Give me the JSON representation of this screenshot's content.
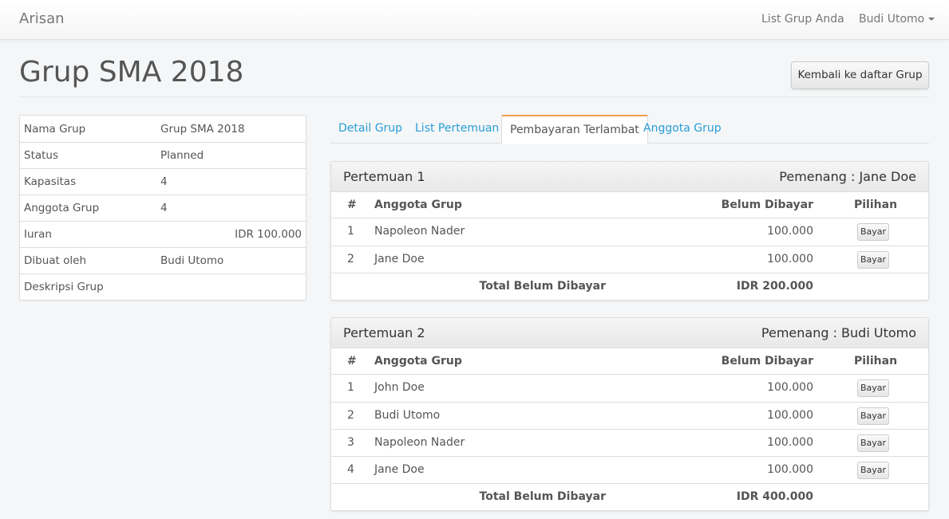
{
  "navbar": {
    "brand": "Arisan",
    "list_grup": "List Grup Anda",
    "user": "Budi Utomo"
  },
  "page": {
    "title": "Grup SMA 2018",
    "back_button": "Kembali ke daftar Grup"
  },
  "info": [
    {
      "label": "Nama Grup",
      "value": "Grup SMA 2018"
    },
    {
      "label": "Status",
      "value": "Planned"
    },
    {
      "label": "Kapasitas",
      "value": "4"
    },
    {
      "label": "Anggota Grup",
      "value": "4"
    },
    {
      "label": "Iuran",
      "value": "IDR 100.000"
    },
    {
      "label": "Dibuat oleh",
      "value": "Budi Utomo"
    },
    {
      "label": "Deskripsi Grup",
      "value": ""
    }
  ],
  "tabs": [
    {
      "label": "Detail Grup"
    },
    {
      "label": "List Pertemuan"
    },
    {
      "label": "Pembayaran Terlambat"
    },
    {
      "label": "Anggota Grup"
    }
  ],
  "table_headers": {
    "no": "#",
    "member": "Anggota Grup",
    "unpaid": "Belum Dibayar",
    "option": "Pilihan"
  },
  "pay_button": "Bayar",
  "total_label": "Total Belum Dibayar",
  "meetings": [
    {
      "title": "Pertemuan 1",
      "winner": "Pemenang : Jane Doe",
      "rows": [
        {
          "no": "1",
          "name": "Napoleon Nader",
          "amount": "100.000"
        },
        {
          "no": "2",
          "name": "Jane Doe",
          "amount": "100.000"
        }
      ],
      "total": "IDR 200.000"
    },
    {
      "title": "Pertemuan 2",
      "winner": "Pemenang : Budi Utomo",
      "rows": [
        {
          "no": "1",
          "name": "John Doe",
          "amount": "100.000"
        },
        {
          "no": "2",
          "name": "Budi Utomo",
          "amount": "100.000"
        },
        {
          "no": "3",
          "name": "Napoleon Nader",
          "amount": "100.000"
        },
        {
          "no": "4",
          "name": "Jane Doe",
          "amount": "100.000"
        }
      ],
      "total": "IDR 400.000"
    }
  ],
  "colors": {
    "accent": "#2a9fd6",
    "active_tab_border": "#f0a04b"
  }
}
